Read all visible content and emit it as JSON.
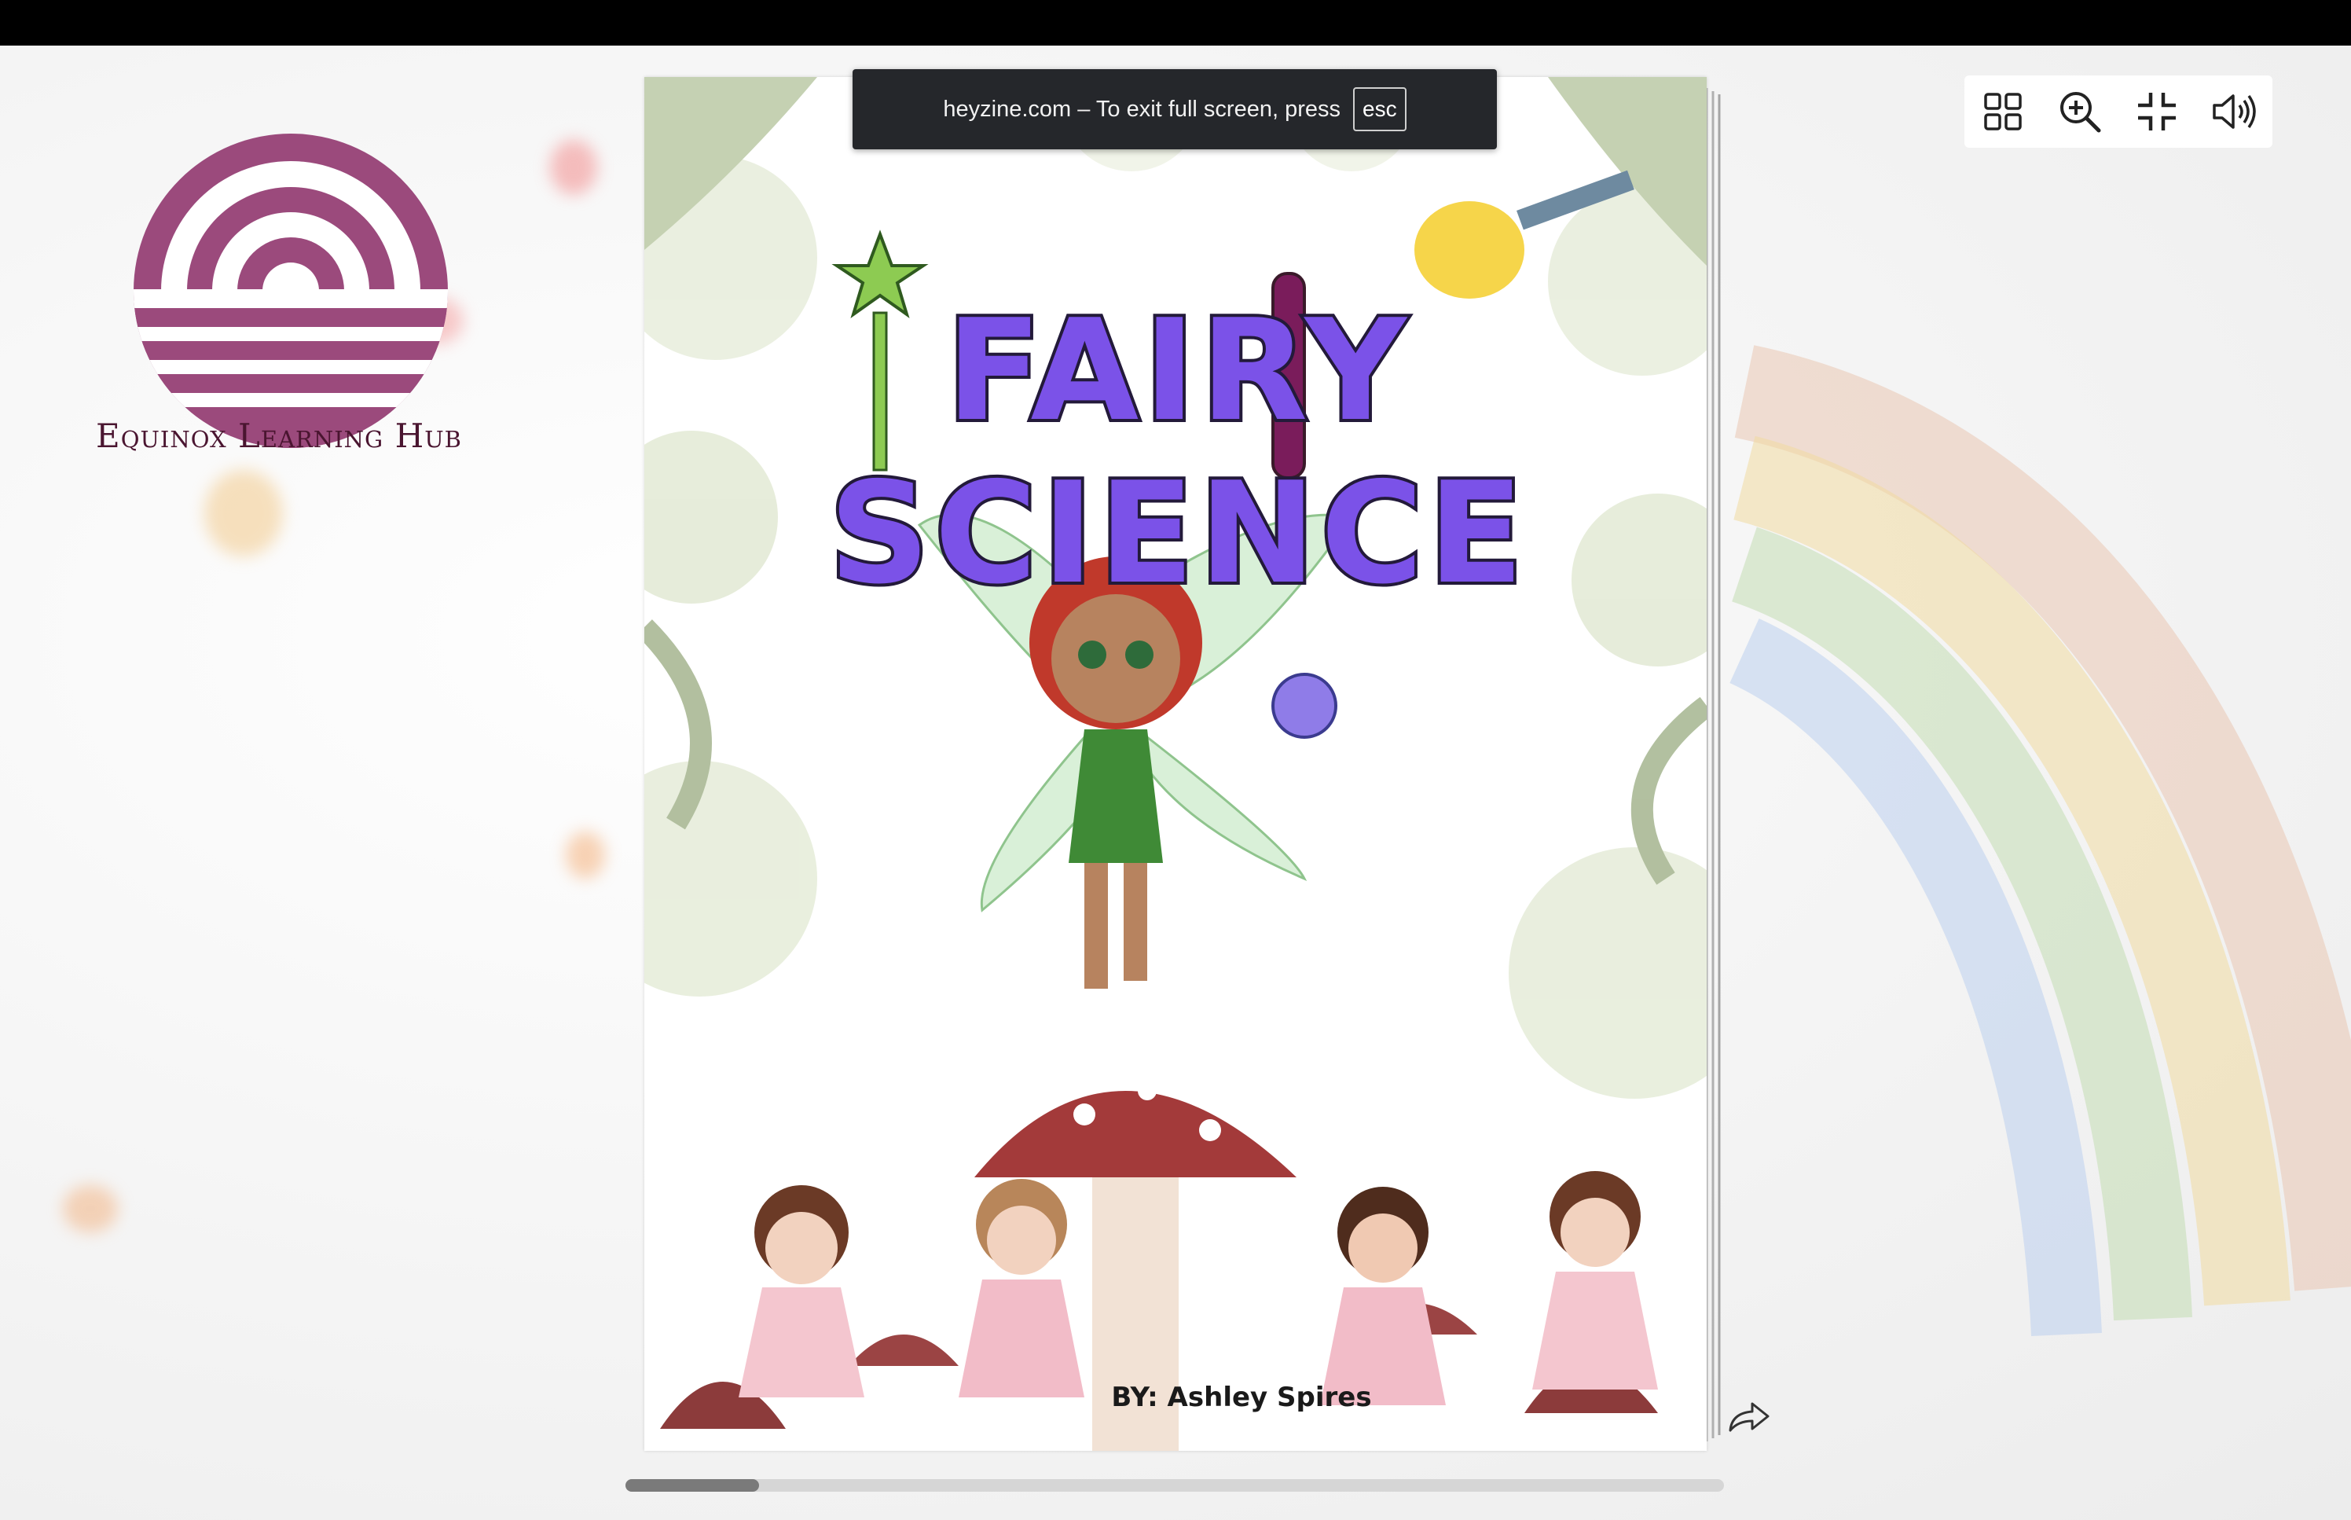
{
  "notice": {
    "message": "heyzine.com – To exit full screen, press",
    "key": "esc"
  },
  "logo": {
    "name": "Equinox Learning Hub",
    "color": "#9b4a7c"
  },
  "toolbar": {
    "icons": [
      "grid-icon",
      "zoom-in-icon",
      "exit-fullscreen-icon",
      "volume-icon"
    ]
  },
  "book": {
    "title": "FAIRY SCIENCE",
    "author": "BY:  Ashley Spires",
    "title_color": "#7b52e8"
  },
  "colors": {
    "accent": "#7b52e8",
    "logo": "#9b4a7c"
  }
}
